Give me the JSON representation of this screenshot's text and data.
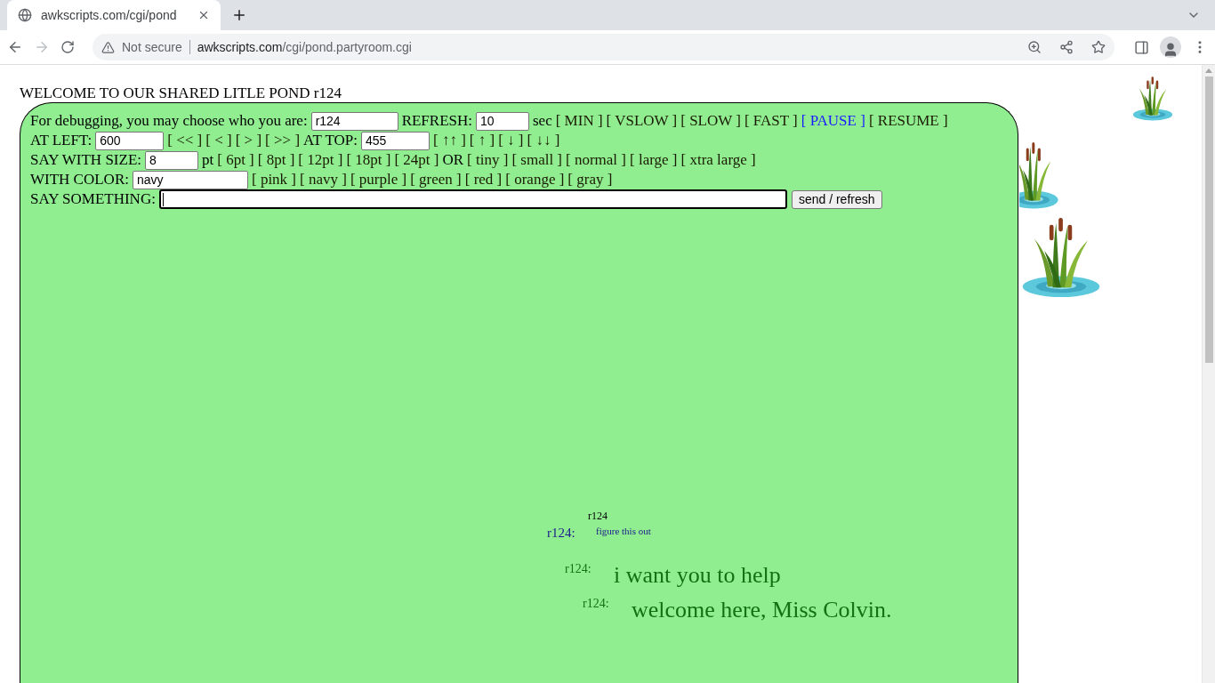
{
  "browser": {
    "tab_title": "awkscripts.com/cgi/pond",
    "security": "Not secure",
    "url_domain": "awkscripts.com",
    "url_path": "/cgi/pond.partyroom.cgi"
  },
  "page": {
    "heading": "WELCOME TO OUR SHARED LITLE POND r124",
    "controls": [
      [
        {
          "kind": "text",
          "text": "For debugging, you may choose who you are:"
        },
        {
          "kind": "field",
          "value": "r124"
        },
        {
          "kind": "text",
          "text": "REFRESH:"
        },
        {
          "kind": "field",
          "value": "10"
        },
        {
          "kind": "text",
          "text": "sec"
        },
        {
          "kind": "link",
          "text": "[ MIN ]",
          "active": false
        },
        {
          "kind": "link",
          "text": "[ VSLOW ]",
          "active": false
        },
        {
          "kind": "link",
          "text": "[ SLOW ]",
          "active": false
        },
        {
          "kind": "link",
          "text": "[ FAST ]",
          "active": false
        },
        {
          "kind": "link",
          "text": "[ PAUSE ]",
          "active": true
        },
        {
          "kind": "link",
          "text": "[ RESUME ]",
          "active": false
        }
      ],
      [
        {
          "kind": "text",
          "text": "AT LEFT:"
        },
        {
          "kind": "field",
          "value": "600"
        },
        {
          "kind": "link",
          "text": "[ << ]",
          "active": false
        },
        {
          "kind": "link",
          "text": "[ < ]",
          "active": false
        },
        {
          "kind": "link",
          "text": "[ > ]",
          "active": false
        },
        {
          "kind": "link",
          "text": "[ >> ]",
          "active": false
        },
        {
          "kind": "text",
          "text": "AT TOP:"
        },
        {
          "kind": "field",
          "value": "455"
        },
        {
          "kind": "link",
          "text": "[ ↑↑ ]",
          "active": false
        },
        {
          "kind": "link",
          "text": "[ ↑ ]",
          "active": false
        },
        {
          "kind": "link",
          "text": "[ ↓ ]",
          "active": false
        },
        {
          "kind": "link",
          "text": "[ ↓↓ ]",
          "active": false
        }
      ],
      [
        {
          "kind": "text",
          "text": "SAY WITH SIZE:"
        },
        {
          "kind": "field",
          "value": "8"
        },
        {
          "kind": "text",
          "text": "pt"
        },
        {
          "kind": "link",
          "text": "[ 6pt ]",
          "active": false
        },
        {
          "kind": "link",
          "text": "[ 8pt ]",
          "active": false
        },
        {
          "kind": "link",
          "text": "[ 12pt ]",
          "active": false
        },
        {
          "kind": "link",
          "text": "[ 18pt ]",
          "active": false
        },
        {
          "kind": "link",
          "text": "[ 24pt ]",
          "active": false
        },
        {
          "kind": "text",
          "text": "OR"
        },
        {
          "kind": "link",
          "text": "[ tiny ]",
          "active": false
        },
        {
          "kind": "link",
          "text": "[ small ]",
          "active": false
        },
        {
          "kind": "link",
          "text": "[ normal ]",
          "active": false
        },
        {
          "kind": "link",
          "text": "[ large ]",
          "active": false
        },
        {
          "kind": "link",
          "text": "[ xtra large ]",
          "active": false
        }
      ],
      [
        {
          "kind": "text",
          "text": "WITH COLOR:"
        },
        {
          "kind": "field",
          "value": "navy"
        },
        {
          "kind": "link",
          "text": "[ pink ]",
          "active": false
        },
        {
          "kind": "link",
          "text": "[ navy ]",
          "active": false
        },
        {
          "kind": "link",
          "text": "[ purple ]",
          "active": false
        },
        {
          "kind": "link",
          "text": "[ green ]",
          "active": false
        },
        {
          "kind": "link",
          "text": "[ red ]",
          "active": false
        },
        {
          "kind": "link",
          "text": "[ orange ]",
          "active": false
        },
        {
          "kind": "link",
          "text": "[ gray ]",
          "active": false
        }
      ],
      [
        {
          "kind": "text",
          "text": "SAY SOMETHING:"
        },
        {
          "kind": "input",
          "focused": true
        },
        {
          "kind": "button",
          "text": "send / refresh"
        }
      ]
    ],
    "messages": [
      {
        "label": "r124",
        "color": "#000000"
      },
      {
        "label": "r124:",
        "text": "figure this out",
        "color": "#1a1a8c"
      },
      {
        "label": "r124:",
        "text": "i want you to help",
        "color": "#137113"
      },
      {
        "label": "r124:",
        "text": "welcome here, Miss Colvin.",
        "color": "#137113"
      }
    ]
  }
}
